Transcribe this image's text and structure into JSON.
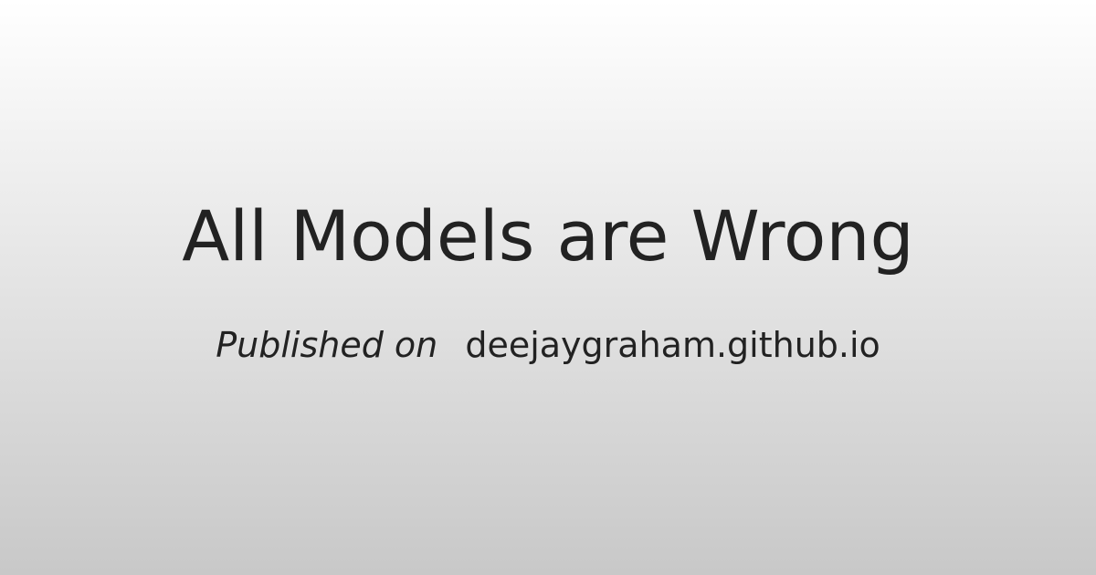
{
  "title": "All Models are Wrong",
  "byline": {
    "prefix": "Published on",
    "site": "deejaygraham.github.io"
  },
  "colors": {
    "text": "#222222",
    "background_top": "#ffffff",
    "background_bottom": "#c8c8c8"
  }
}
